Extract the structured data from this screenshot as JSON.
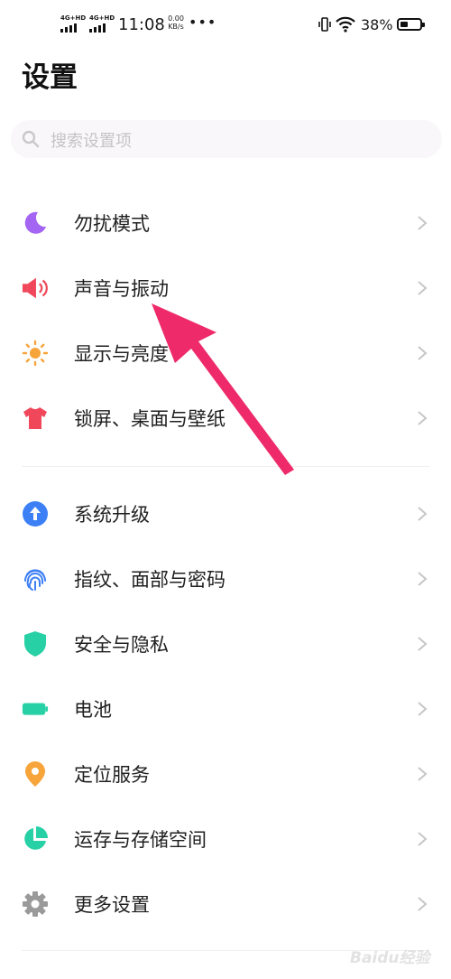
{
  "status_bar": {
    "network_1": "4G+HD",
    "network_2": "4G+HD",
    "time": "11:08",
    "speed_value": "0.00",
    "speed_unit": "KB/s",
    "more": "•••",
    "battery": "38%",
    "battery_level": 0.38
  },
  "page": {
    "title": "设置"
  },
  "search": {
    "placeholder": "搜索设置项"
  },
  "groups": [
    {
      "items": [
        {
          "label": "勿扰模式",
          "icon": "moon-icon",
          "color": "#a365f2"
        },
        {
          "label": "声音与振动",
          "icon": "speaker-icon",
          "color": "#f0485a"
        },
        {
          "label": "显示与亮度",
          "icon": "sun-icon",
          "color": "#f7a43a"
        },
        {
          "label": "锁屏、桌面与壁纸",
          "icon": "tshirt-icon",
          "color": "#f0485a"
        }
      ]
    },
    {
      "items": [
        {
          "label": "系统升级",
          "icon": "upgrade-arrow-icon",
          "color": "#3d7ff5"
        },
        {
          "label": "指纹、面部与密码",
          "icon": "fingerprint-icon",
          "color": "#3d7ff5"
        },
        {
          "label": "安全与隐私",
          "icon": "shield-icon",
          "color": "#27d1a5"
        },
        {
          "label": "电池",
          "icon": "battery-icon",
          "color": "#27d1a5"
        },
        {
          "label": "定位服务",
          "icon": "location-pin-icon",
          "color": "#f7a43a"
        },
        {
          "label": "运存与存储空间",
          "icon": "pie-chart-icon",
          "color": "#27d1a5"
        },
        {
          "label": "更多设置",
          "icon": "gear-icon",
          "color": "#9a9a9a"
        }
      ]
    }
  ],
  "annotation": {
    "arrow_color": "#ee2a6b"
  },
  "watermark": {
    "text": "Baidu经验"
  }
}
